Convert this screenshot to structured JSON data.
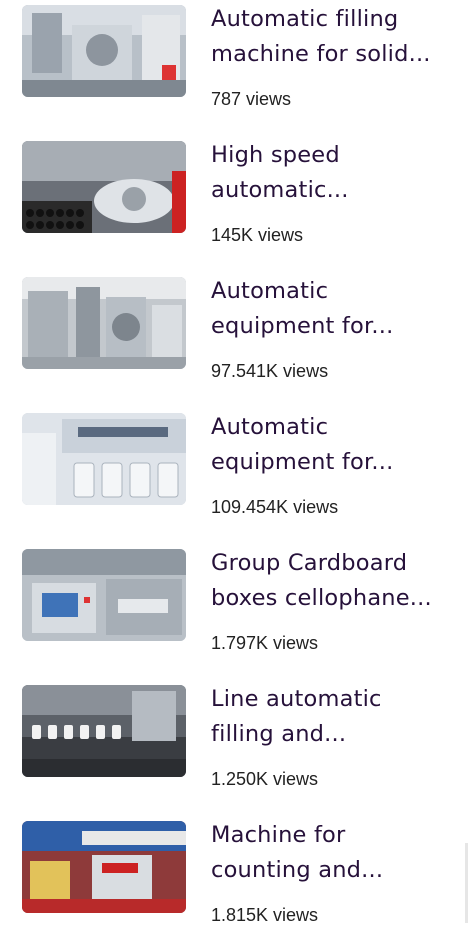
{
  "videos": [
    {
      "title_line1": "Automatic filling",
      "title_line2": "machine for solid...",
      "views": "787 views",
      "thumb_icon": "filling-machine-thumbnail"
    },
    {
      "title_line1": "High speed",
      "title_line2": "automatic...",
      "views": "145K views",
      "thumb_icon": "bottle-capping-thumbnail"
    },
    {
      "title_line1": "Automatic",
      "title_line2": "equipment for...",
      "views": "97.541K views",
      "thumb_icon": "capsule-equipment-thumbnail"
    },
    {
      "title_line1": "Automatic",
      "title_line2": "equipment for...",
      "views": "109.454K views",
      "thumb_icon": "dissolution-tester-thumbnail"
    },
    {
      "title_line1": "Group Cardboard",
      "title_line2": "boxes cellophane...",
      "views": "1.797K views",
      "thumb_icon": "cellophane-wrapper-thumbnail"
    },
    {
      "title_line1": "Line automatic",
      "title_line2": "filling and...",
      "views": "1.250K views",
      "thumb_icon": "filling-line-thumbnail"
    },
    {
      "title_line1": "Machine for",
      "title_line2": "counting and...",
      "views": "1.815K views",
      "thumb_icon": "counting-machine-thumbnail"
    }
  ],
  "colors": {
    "title": "#26113a",
    "views": "#222222"
  }
}
